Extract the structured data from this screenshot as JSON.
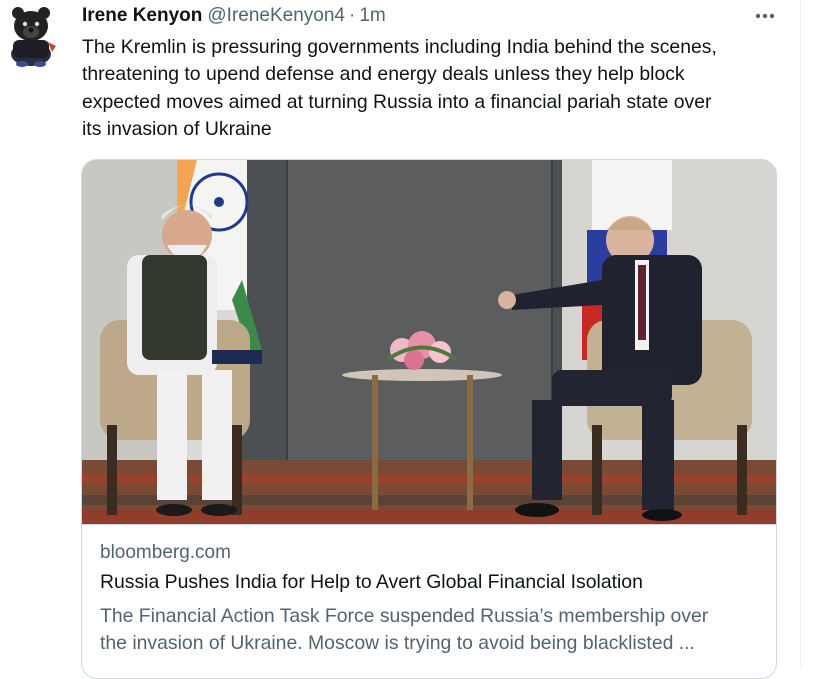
{
  "tweet": {
    "author_name": "Irene Kenyon",
    "author_handle": "@IreneKenyon4",
    "separator": "·",
    "time": "1m",
    "text": "The Kremlin is pressuring governments including India behind the scenes,\nthreatening to upend defense and energy deals unless they help block\nexpected moves aimed at turning Russia into a financial pariah state over\nits invasion of Ukraine",
    "more_icon": "more-horizontal-icon"
  },
  "link_card": {
    "domain": "bloomberg.com",
    "title": "Russia Pushes India for Help to Avert Global Financial Isolation",
    "description": "The Financial Action Task Force suspended Russia’s membership over\nthe invasion of Ukraine. Moscow is trying to avoid being blacklisted ..."
  },
  "colors": {
    "text_primary": "#0f1419",
    "text_secondary": "#536471",
    "border": "#cfd9de"
  }
}
